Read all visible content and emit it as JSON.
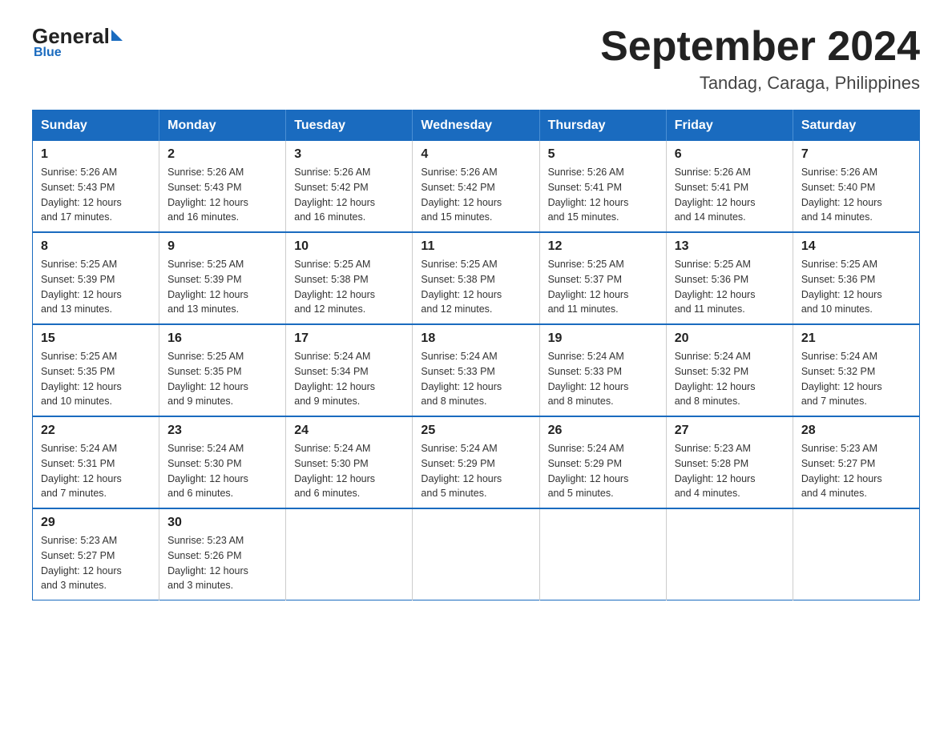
{
  "logo": {
    "general": "General",
    "blue": "Blue"
  },
  "title": "September 2024",
  "subtitle": "Tandag, Caraga, Philippines",
  "days_of_week": [
    "Sunday",
    "Monday",
    "Tuesday",
    "Wednesday",
    "Thursday",
    "Friday",
    "Saturday"
  ],
  "weeks": [
    [
      {
        "day": "1",
        "sunrise": "5:26 AM",
        "sunset": "5:43 PM",
        "daylight": "12 hours and 17 minutes."
      },
      {
        "day": "2",
        "sunrise": "5:26 AM",
        "sunset": "5:43 PM",
        "daylight": "12 hours and 16 minutes."
      },
      {
        "day": "3",
        "sunrise": "5:26 AM",
        "sunset": "5:42 PM",
        "daylight": "12 hours and 16 minutes."
      },
      {
        "day": "4",
        "sunrise": "5:26 AM",
        "sunset": "5:42 PM",
        "daylight": "12 hours and 15 minutes."
      },
      {
        "day": "5",
        "sunrise": "5:26 AM",
        "sunset": "5:41 PM",
        "daylight": "12 hours and 15 minutes."
      },
      {
        "day": "6",
        "sunrise": "5:26 AM",
        "sunset": "5:41 PM",
        "daylight": "12 hours and 14 minutes."
      },
      {
        "day": "7",
        "sunrise": "5:26 AM",
        "sunset": "5:40 PM",
        "daylight": "12 hours and 14 minutes."
      }
    ],
    [
      {
        "day": "8",
        "sunrise": "5:25 AM",
        "sunset": "5:39 PM",
        "daylight": "12 hours and 13 minutes."
      },
      {
        "day": "9",
        "sunrise": "5:25 AM",
        "sunset": "5:39 PM",
        "daylight": "12 hours and 13 minutes."
      },
      {
        "day": "10",
        "sunrise": "5:25 AM",
        "sunset": "5:38 PM",
        "daylight": "12 hours and 12 minutes."
      },
      {
        "day": "11",
        "sunrise": "5:25 AM",
        "sunset": "5:38 PM",
        "daylight": "12 hours and 12 minutes."
      },
      {
        "day": "12",
        "sunrise": "5:25 AM",
        "sunset": "5:37 PM",
        "daylight": "12 hours and 11 minutes."
      },
      {
        "day": "13",
        "sunrise": "5:25 AM",
        "sunset": "5:36 PM",
        "daylight": "12 hours and 11 minutes."
      },
      {
        "day": "14",
        "sunrise": "5:25 AM",
        "sunset": "5:36 PM",
        "daylight": "12 hours and 10 minutes."
      }
    ],
    [
      {
        "day": "15",
        "sunrise": "5:25 AM",
        "sunset": "5:35 PM",
        "daylight": "12 hours and 10 minutes."
      },
      {
        "day": "16",
        "sunrise": "5:25 AM",
        "sunset": "5:35 PM",
        "daylight": "12 hours and 9 minutes."
      },
      {
        "day": "17",
        "sunrise": "5:24 AM",
        "sunset": "5:34 PM",
        "daylight": "12 hours and 9 minutes."
      },
      {
        "day": "18",
        "sunrise": "5:24 AM",
        "sunset": "5:33 PM",
        "daylight": "12 hours and 8 minutes."
      },
      {
        "day": "19",
        "sunrise": "5:24 AM",
        "sunset": "5:33 PM",
        "daylight": "12 hours and 8 minutes."
      },
      {
        "day": "20",
        "sunrise": "5:24 AM",
        "sunset": "5:32 PM",
        "daylight": "12 hours and 8 minutes."
      },
      {
        "day": "21",
        "sunrise": "5:24 AM",
        "sunset": "5:32 PM",
        "daylight": "12 hours and 7 minutes."
      }
    ],
    [
      {
        "day": "22",
        "sunrise": "5:24 AM",
        "sunset": "5:31 PM",
        "daylight": "12 hours and 7 minutes."
      },
      {
        "day": "23",
        "sunrise": "5:24 AM",
        "sunset": "5:30 PM",
        "daylight": "12 hours and 6 minutes."
      },
      {
        "day": "24",
        "sunrise": "5:24 AM",
        "sunset": "5:30 PM",
        "daylight": "12 hours and 6 minutes."
      },
      {
        "day": "25",
        "sunrise": "5:24 AM",
        "sunset": "5:29 PM",
        "daylight": "12 hours and 5 minutes."
      },
      {
        "day": "26",
        "sunrise": "5:24 AM",
        "sunset": "5:29 PM",
        "daylight": "12 hours and 5 minutes."
      },
      {
        "day": "27",
        "sunrise": "5:23 AM",
        "sunset": "5:28 PM",
        "daylight": "12 hours and 4 minutes."
      },
      {
        "day": "28",
        "sunrise": "5:23 AM",
        "sunset": "5:27 PM",
        "daylight": "12 hours and 4 minutes."
      }
    ],
    [
      {
        "day": "29",
        "sunrise": "5:23 AM",
        "sunset": "5:27 PM",
        "daylight": "12 hours and 3 minutes."
      },
      {
        "day": "30",
        "sunrise": "5:23 AM",
        "sunset": "5:26 PM",
        "daylight": "12 hours and 3 minutes."
      },
      null,
      null,
      null,
      null,
      null
    ]
  ],
  "labels": {
    "sunrise": "Sunrise:",
    "sunset": "Sunset:",
    "daylight": "Daylight:"
  }
}
